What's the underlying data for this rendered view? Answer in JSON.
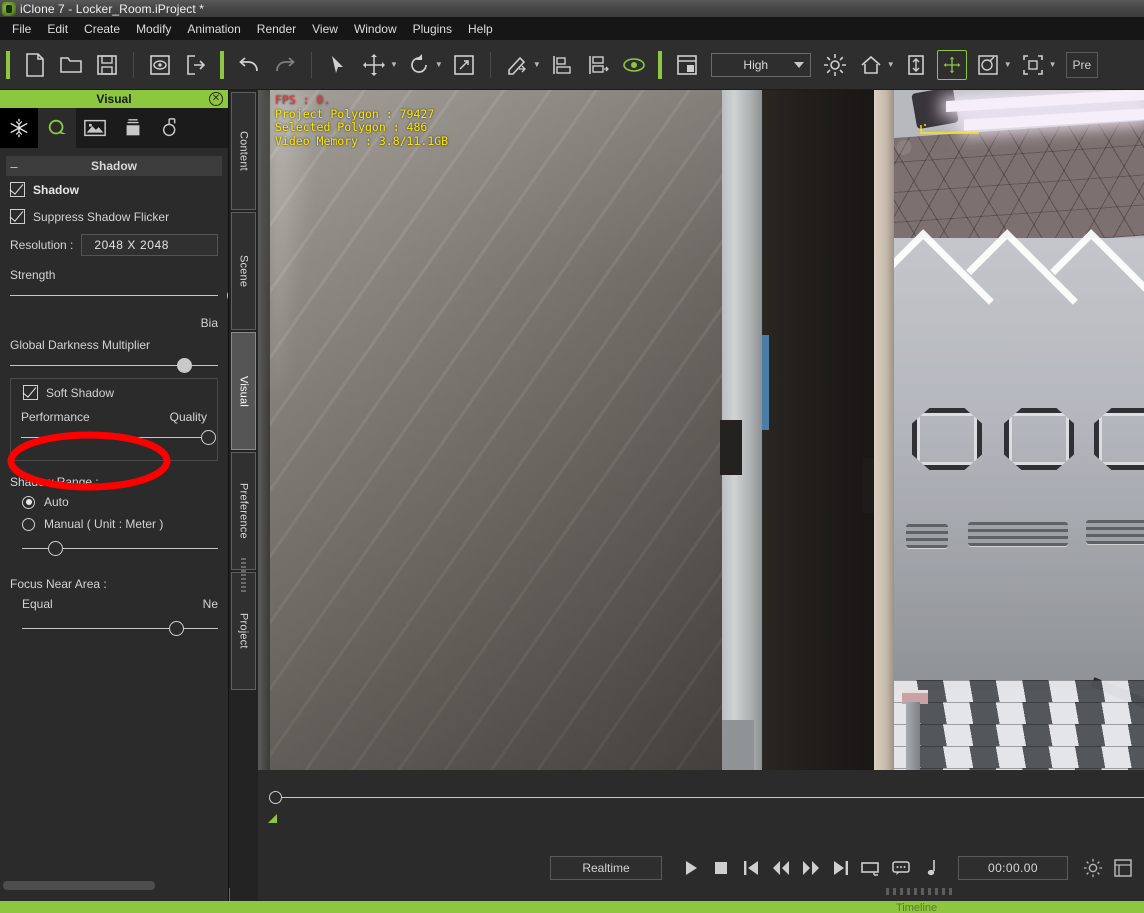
{
  "titlebar": {
    "title": "iClone 7 - Locker_Room.iProject *",
    "logo_icon": "iclone-logo-icon"
  },
  "menubar": {
    "items": [
      {
        "label": "File"
      },
      {
        "label": "Edit"
      },
      {
        "label": "Create"
      },
      {
        "label": "Modify"
      },
      {
        "label": "Animation"
      },
      {
        "label": "Render"
      },
      {
        "label": "View"
      },
      {
        "label": "Window"
      },
      {
        "label": "Plugins"
      },
      {
        "label": "Help"
      }
    ]
  },
  "toolbar": {
    "quality": {
      "value": "High",
      "caret_icon": "chevron-down-icon"
    },
    "preview_label": "Pre",
    "buttons": [
      {
        "name": "new-project-button",
        "icon": "new-document-icon"
      },
      {
        "name": "open-project-button",
        "icon": "open-folder-icon"
      },
      {
        "name": "save-project-button",
        "icon": "floppy-save-icon"
      },
      {
        "name": "preview-button",
        "icon": "eye-in-box-icon"
      },
      {
        "name": "export-button",
        "icon": "export-arrow-icon"
      },
      {
        "name": "undo-button",
        "icon": "undo-arrow-icon"
      },
      {
        "name": "redo-button",
        "icon": "redo-arrow-icon"
      },
      {
        "name": "select-tool-button",
        "icon": "cursor-arrow-icon"
      },
      {
        "name": "move-tool-button",
        "icon": "move-cross-icon"
      },
      {
        "name": "rotate-tool-button",
        "icon": "rotate-circle-icon"
      },
      {
        "name": "scale-tool-button",
        "icon": "scale-expand-icon"
      },
      {
        "name": "paint-tool-button",
        "icon": "brush-icon"
      },
      {
        "name": "align-button",
        "icon": "align-bottom-icon"
      },
      {
        "name": "align-step-button",
        "icon": "align-step-icon"
      },
      {
        "name": "visibility-button",
        "icon": "green-eye-icon"
      },
      {
        "name": "layout-button",
        "icon": "window-layout-icon"
      },
      {
        "name": "light-button",
        "icon": "sun-light-icon"
      },
      {
        "name": "home-button",
        "icon": "home-icon"
      },
      {
        "name": "ground-button",
        "icon": "vertical-arrows-icon"
      },
      {
        "name": "transform-button",
        "icon": "move-gizmo-icon"
      },
      {
        "name": "material-button",
        "icon": "palette-icon"
      },
      {
        "name": "frame-button",
        "icon": "frame-selection-icon"
      }
    ]
  },
  "left_panel": {
    "header": {
      "title": "Visual",
      "close_icon": "close-circle-icon"
    },
    "tabs": [
      {
        "name": "effects-tab",
        "icon": "snowflake-icon",
        "active": false
      },
      {
        "name": "visual-tab",
        "icon": "green-sphere-icon",
        "active": true
      },
      {
        "name": "image-tab",
        "icon": "image-icon",
        "active": false
      },
      {
        "name": "box-tab",
        "icon": "box-icon",
        "active": false
      },
      {
        "name": "light-probe-tab",
        "icon": "probe-arrow-icon",
        "active": false
      }
    ],
    "section": {
      "title": "Shadow",
      "collapse_icon": "minus-icon"
    },
    "shadow_checkbox": {
      "label": "Shadow",
      "checked": true
    },
    "suppress_flicker_checkbox": {
      "label": "Suppress Shadow Flicker",
      "checked": true
    },
    "resolution": {
      "label": "Resolution :",
      "value": "2048 X 2048"
    },
    "strength": {
      "label": "Strength",
      "percent": 100
    },
    "bias": {
      "label": "Bia"
    },
    "global_darkness": {
      "label": "Global Darkness Multiplier",
      "percent": 79
    },
    "soft_shadow": {
      "label": "Soft Shadow",
      "checked": true
    },
    "quality_slider": {
      "left_label": "Performance",
      "right_label": "Quality",
      "percent": 96
    },
    "shadow_range": {
      "label": "Shadow Range :",
      "auto": {
        "label": "Auto",
        "selected": true
      },
      "manual": {
        "label": "Manual ( Unit : Meter )",
        "selected": false
      },
      "slider_percent": 13
    },
    "focus_near_area": {
      "label": "Focus Near Area :",
      "left_label": "Equal",
      "right_label": "Ne",
      "percent": 71
    }
  },
  "vertical_tabs": [
    {
      "label": "Content",
      "active": false
    },
    {
      "label": "Scene",
      "active": false
    },
    {
      "label": "Visual",
      "active": true
    },
    {
      "label": "Preference",
      "active": false
    },
    {
      "label": "Project",
      "active": false
    }
  ],
  "viewport": {
    "stats": {
      "fps": "FPS : 0.",
      "project_polygon": "Project Polygon : 79427",
      "selected_polygon": "Selected Polygon : 486",
      "video_memory": "Video Memory : 3.8/11.1GB"
    }
  },
  "playback": {
    "mode_label": "Realtime",
    "timecode": "00:00.00",
    "buttons": [
      {
        "name": "play-button",
        "icon": "play-icon"
      },
      {
        "name": "stop-button",
        "icon": "stop-icon"
      },
      {
        "name": "go-to-start-button",
        "icon": "skip-back-icon"
      },
      {
        "name": "rewind-button",
        "icon": "rewind-icon"
      },
      {
        "name": "fast-forward-button",
        "icon": "fast-forward-icon"
      },
      {
        "name": "go-to-end-button",
        "icon": "skip-forward-icon"
      },
      {
        "name": "loop-button",
        "icon": "loop-rect-icon"
      },
      {
        "name": "comment-button",
        "icon": "speech-bubble-icon"
      },
      {
        "name": "audio-button",
        "icon": "music-note-icon"
      },
      {
        "name": "settings-button",
        "icon": "sun-gear-icon"
      },
      {
        "name": "list-button",
        "icon": "list-panel-icon"
      }
    ]
  },
  "statusbar": {
    "label": "Timeline"
  },
  "colors": {
    "accent_green": "#8dc63f",
    "panel_bg": "#2b2b2b",
    "menu_bg": "#161616",
    "annotation_red": "#ff0000",
    "stat_red": "#ff2b2b",
    "stat_yellow": "#ffe800"
  }
}
